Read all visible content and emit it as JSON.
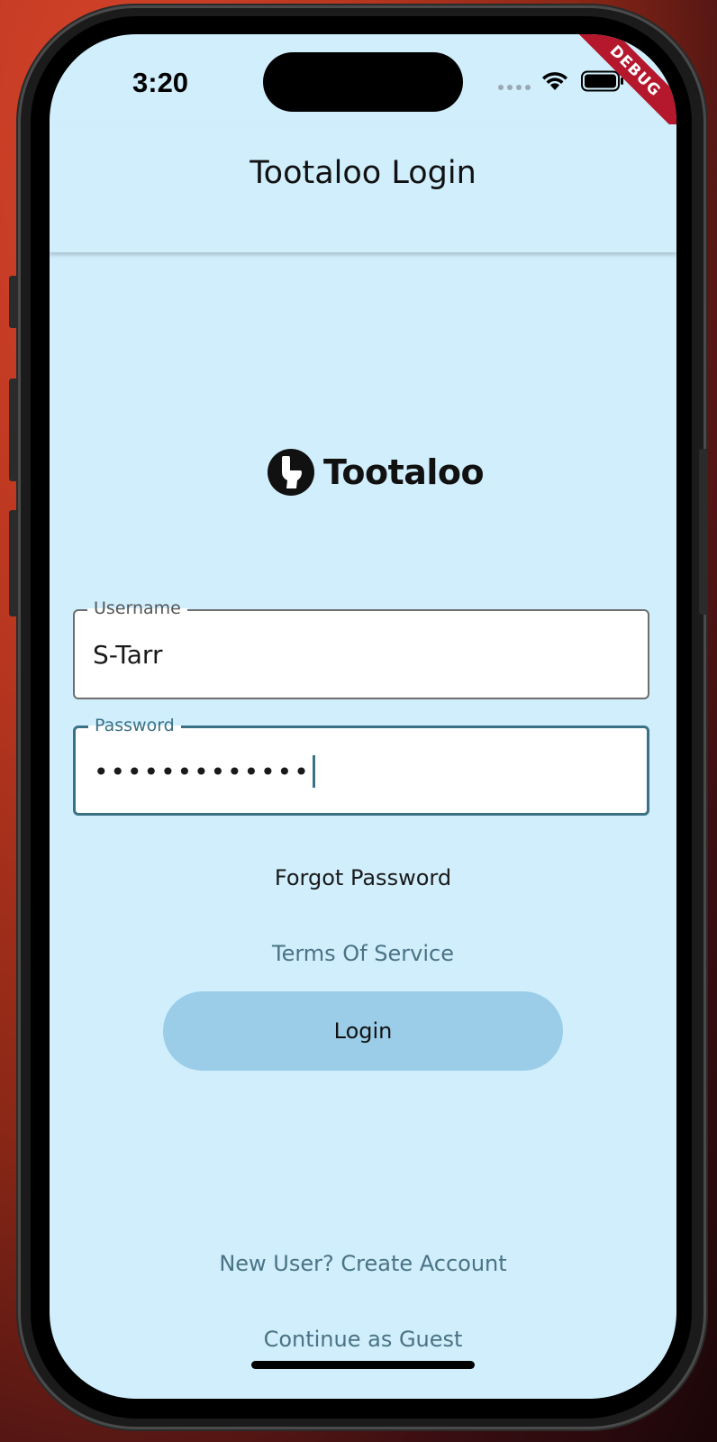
{
  "status": {
    "time": "3:20",
    "debug_banner": "DEBUG"
  },
  "appbar": {
    "title": "Tootaloo Login"
  },
  "logo": {
    "text": "Tootaloo"
  },
  "form": {
    "username": {
      "label": "Username",
      "value": "S-Tarr"
    },
    "password": {
      "label": "Password",
      "masked_value": "•••••••••••••"
    }
  },
  "links": {
    "forgot_password": "Forgot Password",
    "terms": "Terms Of Service",
    "create_account": "New User? Create Account",
    "guest": "Continue as Guest"
  },
  "buttons": {
    "login": "Login"
  },
  "colors": {
    "background": "#d0eefc",
    "primary_button": "#9bcde8",
    "accent": "#3b7185",
    "link": "#4a7385",
    "debug": "#b5172c"
  }
}
